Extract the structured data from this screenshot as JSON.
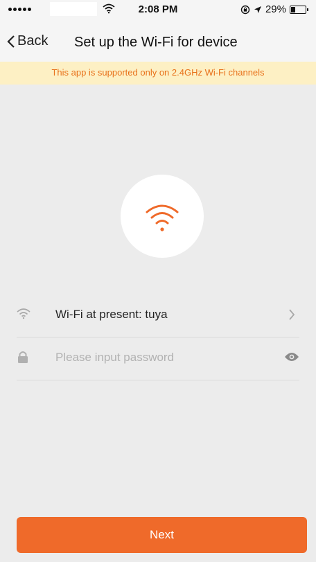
{
  "status_bar": {
    "time": "2:08 PM",
    "battery_text": "29%",
    "battery_level": 0.29,
    "icons": [
      "signal-dots-icon",
      "wifi-icon",
      "lock-rotation-icon",
      "location-arrow-icon",
      "battery-icon"
    ]
  },
  "nav": {
    "back_label": "Back",
    "title": "Set up the Wi-Fi for device"
  },
  "notice": {
    "text": "This app is supported only on 2.4GHz Wi-Fi channels"
  },
  "wifi_row": {
    "label": "Wi-Fi at present: tuya"
  },
  "password": {
    "value": "",
    "placeholder": "Please input password"
  },
  "next_button": {
    "label": "Next"
  },
  "colors": {
    "accent": "#ef6a2a",
    "notice_text": "#e8711a",
    "notice_background": "#fdf0c4",
    "background": "#ececec"
  }
}
